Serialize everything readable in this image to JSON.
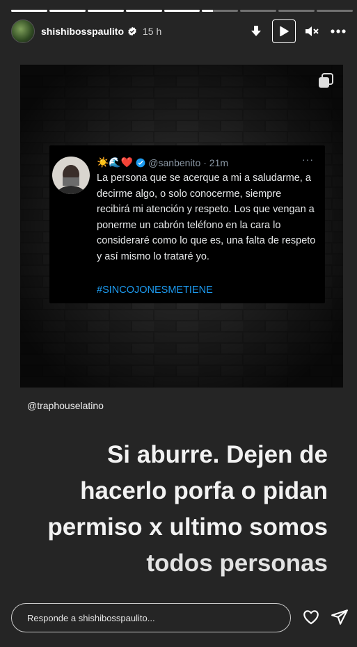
{
  "story": {
    "progress": {
      "segments": 9,
      "completed": 5,
      "current_fraction": 0.3
    },
    "header": {
      "username": "shishibosspaulito",
      "time": "15 h",
      "icons": [
        "arrow-down-icon",
        "play-icon",
        "mute-icon",
        "more-icon"
      ]
    },
    "media": {
      "tweet": {
        "emojis": "☀️🌊❤️",
        "handle": "@sanbenito",
        "time": "· 21m",
        "dots": "···",
        "text": "La persona que se acerque a mi a saludarme, a decirme algo, o solo conocerme, siempre recibirá mi atención y respeto. Los que vengan a ponerme un cabrón teléfono en la cara lo consideraré como lo que es, una falta de respeto y así mismo lo trataré yo.",
        "hashtag": "#SINCOJONESMETIENE"
      },
      "credit": "@traphouselatino"
    },
    "caption": [
      "Si aburre. Dejen de",
      "hacerlo porfa o pidan",
      "permiso x ultimo somos",
      "todos personas"
    ],
    "reply": {
      "placeholder": "Responde a shishibosspaulito..."
    },
    "colors": {
      "background": "#252525",
      "tweet_link": "#1d9bf0",
      "verified": "#1d9bf0"
    }
  }
}
